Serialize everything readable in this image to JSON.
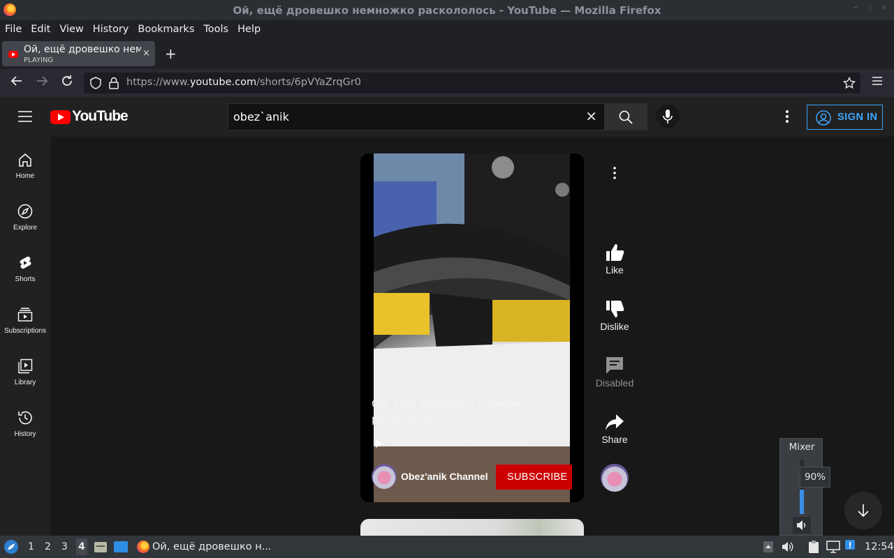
{
  "window": {
    "title": "Ой, ещё дровешко немножко раскололось - YouTube — Mozilla Firefox"
  },
  "menu": {
    "file": "File",
    "edit": "Edit",
    "view": "View",
    "history": "History",
    "bookmarks": "Bookmarks",
    "tools": "Tools",
    "help": "Help"
  },
  "tab": {
    "title": "Ой, ещё дровешко немножко раскололось - YouTube",
    "status": "PLAYING",
    "close": "×",
    "new_tab": "+"
  },
  "address": {
    "prefix": "https://www.",
    "domain": "youtube.com",
    "path": "/shorts/6pVYaZrqGr0"
  },
  "youtube": {
    "logo_text": "YouTube",
    "search_value": "obez`anik",
    "clear": "✕",
    "sign_in": "SIGN IN",
    "sidebar": [
      {
        "label": "Home",
        "icon": "home-icon"
      },
      {
        "label": "Explore",
        "icon": "compass-icon"
      },
      {
        "label": "Shorts",
        "icon": "shorts-icon"
      },
      {
        "label": "Subscriptions",
        "icon": "subscriptions-icon"
      },
      {
        "label": "Library",
        "icon": "library-icon"
      },
      {
        "label": "History",
        "icon": "history-icon"
      }
    ],
    "short": {
      "caption": "Ой, ещё дровешко немножко раскололось",
      "created_from": "Created from Obez'anik Channel",
      "channel": "Obez'anik Channel",
      "subscribe": "SUBSCRIBE"
    },
    "actions": {
      "like": "Like",
      "dislike": "Dislike",
      "comments": "Disabled",
      "share": "Share"
    }
  },
  "mixer": {
    "title": "Mixer",
    "volume": "90%",
    "volume_level": 0.9
  },
  "taskbar": {
    "desktops": [
      "1",
      "2",
      "3",
      "4"
    ],
    "active_desktop": "4",
    "window_label": "Ой, ещё дровешко н...",
    "clock": "12:54"
  },
  "colors": {
    "youtube_red": "#ff0000",
    "subscribe_red": "#cc0000",
    "signin_blue": "#3ea6ff"
  }
}
